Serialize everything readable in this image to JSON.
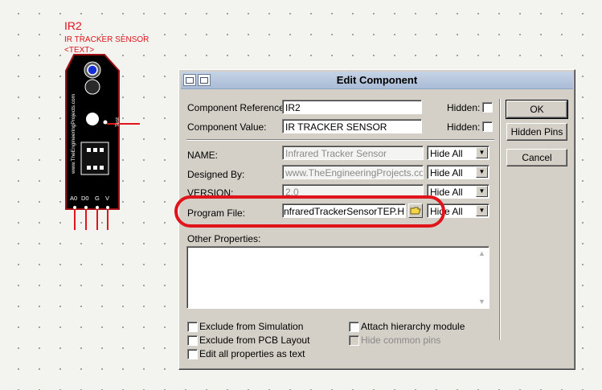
{
  "schematic": {
    "ref": "IR2",
    "value": "IR TRACKER SENSOR",
    "text_tag": "<TEXT>",
    "board_url": "www.TheEngineeringProjects.com",
    "test_label": "Test",
    "pins": [
      "A0",
      "D0",
      "G",
      "V"
    ],
    "colors": {
      "board": "#000000",
      "wire": "#e0141b",
      "sensor_blue": "#1530d6",
      "pcb_edge": "#a01015"
    }
  },
  "dialog": {
    "title": "Edit Component",
    "fields": {
      "component_reference": {
        "label": "Component Reference:",
        "value": "IR2"
      },
      "component_value": {
        "label": "Component Value:",
        "value": "IR TRACKER SENSOR"
      },
      "name": {
        "label": "NAME:",
        "value": "Infrared Tracker Sensor",
        "visibility": "Hide All"
      },
      "designed_by": {
        "label": "Designed By:",
        "value": "www.TheEngineeringProjects.com",
        "visibility": "Hide All"
      },
      "version": {
        "label": "VERSION:",
        "value": "2.0",
        "visibility": "Hide All"
      },
      "program_file": {
        "label": "Program File:",
        "value": "nfraredTrackerSensorTEP.HEX",
        "visibility": "Hide All"
      }
    },
    "hidden_label": "Hidden:",
    "other_properties_label": "Other Properties:",
    "checkboxes": {
      "exclude_simulation": "Exclude from Simulation",
      "exclude_pcb": "Exclude from PCB Layout",
      "edit_all_text": "Edit all properties as text",
      "attach_hierarchy": "Attach hierarchy module",
      "hide_common_pins": "Hide common pins"
    },
    "buttons": {
      "ok": "OK",
      "hidden_pins": "Hidden Pins",
      "cancel": "Cancel"
    },
    "icons": [
      "window-icon",
      "window-icon",
      "folder-icon",
      "dropdown-arrow-icon",
      "scroll-up-icon",
      "scroll-down-icon"
    ]
  }
}
